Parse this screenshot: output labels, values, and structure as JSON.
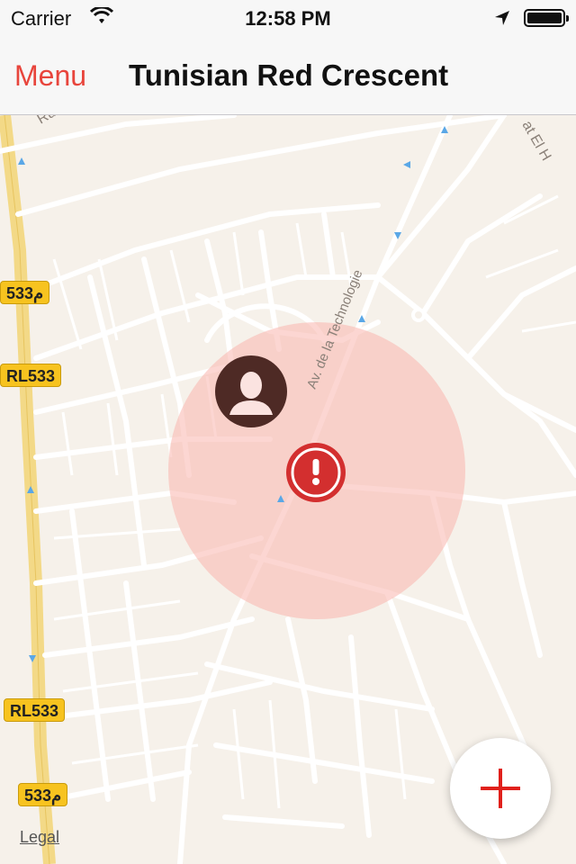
{
  "status_bar": {
    "carrier": "Carrier",
    "time": "12:58 PM"
  },
  "nav": {
    "menu_label": "Menu",
    "title": "Tunisian Red Crescent"
  },
  "map": {
    "street_label": "Av. de la Technologie",
    "road_badges": [
      "533م",
      "RL533",
      "RL533",
      "533م"
    ],
    "corner_labels": [
      "Ru",
      "at El H"
    ],
    "legal": "Legal",
    "zone_color": "#f9b5ad",
    "alert_color": "#d32f2f"
  },
  "fab": {
    "icon": "plus-icon"
  }
}
